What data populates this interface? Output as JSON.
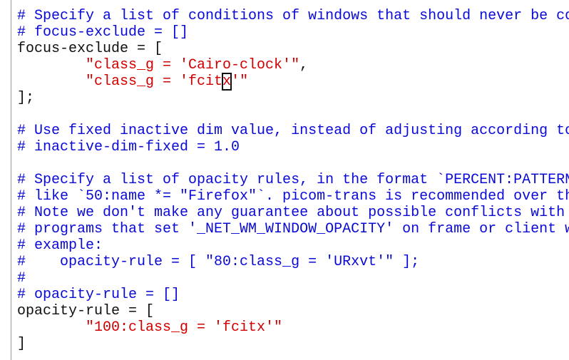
{
  "editor": {
    "lines": [
      {
        "segments": [
          {
            "type": "comment",
            "text": "# Specify a list of conditions of windows that should never be co"
          }
        ]
      },
      {
        "segments": [
          {
            "type": "comment",
            "text": "# focus-exclude = []"
          }
        ]
      },
      {
        "segments": [
          {
            "type": "plain",
            "text": "focus-exclude = ["
          }
        ]
      },
      {
        "segments": [
          {
            "type": "plain",
            "text": "        "
          },
          {
            "type": "string",
            "text": "\"class_g = 'Cairo-clock'\""
          },
          {
            "type": "plain",
            "text": ","
          }
        ]
      },
      {
        "segments": [
          {
            "type": "plain",
            "text": "        "
          },
          {
            "type": "string",
            "text": "\"class_g = 'fcit"
          },
          {
            "type": "cursor",
            "text": "x"
          },
          {
            "type": "string",
            "text": "'\""
          }
        ]
      },
      {
        "segments": [
          {
            "type": "plain",
            "text": "];"
          }
        ]
      },
      {
        "segments": []
      },
      {
        "segments": [
          {
            "type": "comment",
            "text": "# Use fixed inactive dim value, instead of adjusting according to"
          }
        ]
      },
      {
        "segments": [
          {
            "type": "comment",
            "text": "# inactive-dim-fixed = 1.0"
          }
        ]
      },
      {
        "segments": []
      },
      {
        "segments": [
          {
            "type": "comment",
            "text": "# Specify a list of opacity rules, in the format `PERCENT:PATTERN"
          }
        ]
      },
      {
        "segments": [
          {
            "type": "comment",
            "text": "# like `50:name *= \"Firefox\"`. picom-trans is recommended over th"
          }
        ]
      },
      {
        "segments": [
          {
            "type": "comment",
            "text": "# Note we don't make any guarantee about possible conflicts with"
          }
        ]
      },
      {
        "segments": [
          {
            "type": "comment",
            "text": "# programs that set '_NET_WM_WINDOW_OPACITY' on frame or client w"
          }
        ]
      },
      {
        "segments": [
          {
            "type": "comment",
            "text": "# example:"
          }
        ]
      },
      {
        "segments": [
          {
            "type": "comment",
            "text": "#    opacity-rule = [ \"80:class_g = 'URxvt'\" ];"
          }
        ]
      },
      {
        "segments": [
          {
            "type": "comment",
            "text": "#"
          }
        ]
      },
      {
        "segments": [
          {
            "type": "comment",
            "text": "# opacity-rule = []"
          }
        ]
      },
      {
        "segments": [
          {
            "type": "plain",
            "text": "opacity-rule = ["
          }
        ]
      },
      {
        "segments": [
          {
            "type": "plain",
            "text": "        "
          },
          {
            "type": "string",
            "text": "\"100:class_g = 'fcitx'\""
          }
        ]
      },
      {
        "segments": [
          {
            "type": "plain",
            "text": "]"
          }
        ]
      }
    ]
  },
  "colors": {
    "comment": "#0a0ad6",
    "plain": "#101010",
    "string": "#d00000",
    "background": "#ffffff"
  }
}
